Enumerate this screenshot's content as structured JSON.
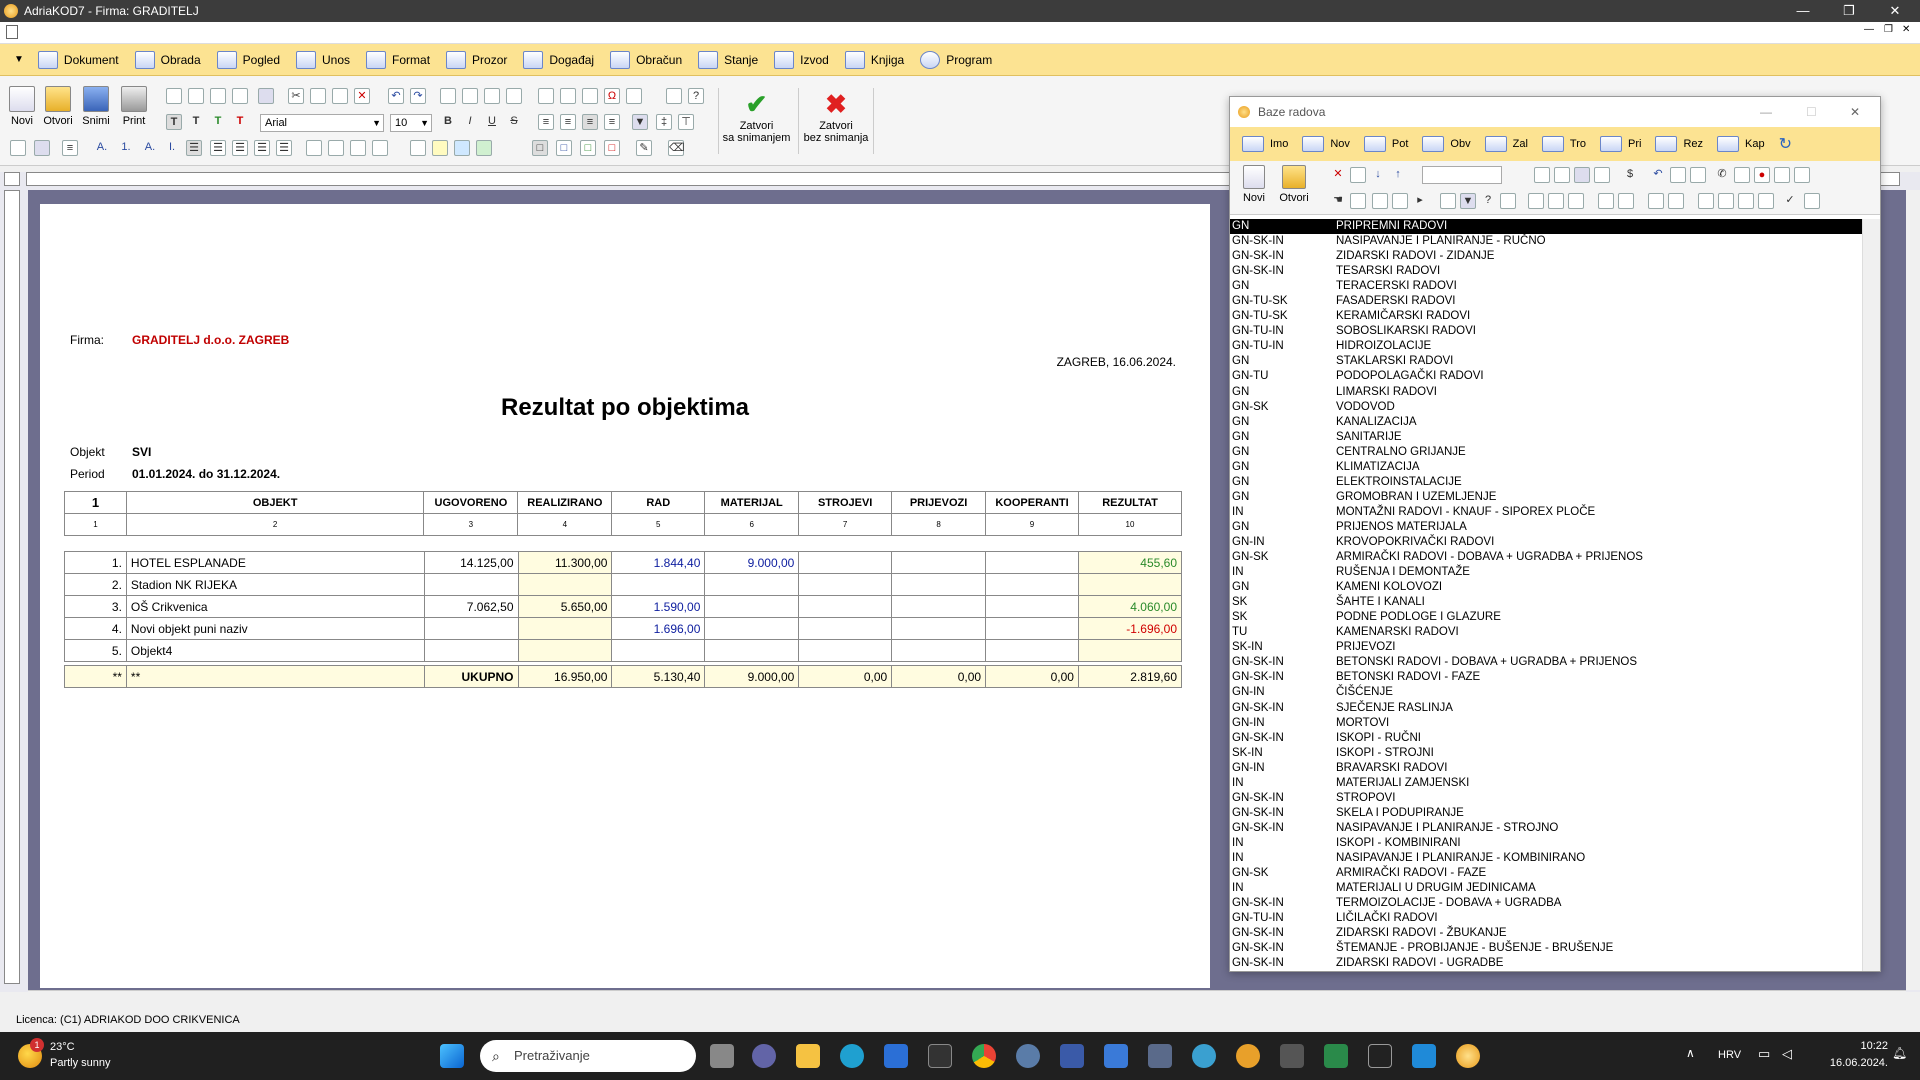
{
  "window": {
    "title": "AdriaKOD7 - Firma: GRADITELJ"
  },
  "menu": [
    {
      "label": "Dokument"
    },
    {
      "label": "Obrada"
    },
    {
      "label": "Pogled"
    },
    {
      "label": "Unos"
    },
    {
      "label": "Format"
    },
    {
      "label": "Prozor"
    },
    {
      "label": "Događaj"
    },
    {
      "label": "Obračun"
    },
    {
      "label": "Stanje"
    },
    {
      "label": "Izvod"
    },
    {
      "label": "Knjiga"
    },
    {
      "label": "Program"
    }
  ],
  "toolbar": {
    "new": "Novi",
    "open": "Otvori",
    "save": "Snimi",
    "print": "Print",
    "font": "Arial",
    "size": "10",
    "close_save_1": "Zatvori",
    "close_save_2": "sa snimanjem",
    "close_nosave_1": "Zatvori",
    "close_nosave_2": "bez snimanja"
  },
  "report": {
    "firma_label": "Firma:",
    "firma": "GRADITELJ d.o.o. ZAGREB",
    "place_date": "ZAGREB, 16.06.2024.",
    "title": "Rezultat po objektima",
    "objekt_label": "Objekt",
    "objekt": "SVI",
    "period_label": "Period",
    "period": "01.01.2024. do 31.12.2024.",
    "headers": [
      "1",
      "OBJEKT",
      "UGOVORENO",
      "REALIZIRANO",
      "RAD",
      "MATERIJAL",
      "STROJEVI",
      "PRIJEVOZI",
      "KOOPERANTI",
      "REZULTAT"
    ],
    "header_idx": [
      "1",
      "2",
      "3",
      "4",
      "5",
      "6",
      "7",
      "8",
      "9",
      "10"
    ],
    "rows": [
      {
        "n": "1.",
        "name": "HOTEL ESPLANADE",
        "ugov": "14.125,00",
        "real": "11.300,00",
        "rad": "1.844,40",
        "mat": "9.000,00",
        "str": "",
        "prij": "",
        "koop": "",
        "rez": "455,60",
        "neg": false
      },
      {
        "n": "2.",
        "name": "Stadion NK RIJEKA",
        "ugov": "",
        "real": "",
        "rad": "",
        "mat": "",
        "str": "",
        "prij": "",
        "koop": "",
        "rez": "",
        "neg": false
      },
      {
        "n": "3.",
        "name": "OŠ Crikvenica",
        "ugov": "7.062,50",
        "real": "5.650,00",
        "rad": "1.590,00",
        "mat": "",
        "str": "",
        "prij": "",
        "koop": "",
        "rez": "4.060,00",
        "neg": false
      },
      {
        "n": "4.",
        "name": "Novi objekt puni naziv",
        "ugov": "",
        "real": "",
        "rad": "1.696,00",
        "mat": "",
        "str": "",
        "prij": "",
        "koop": "",
        "rez": "-1.696,00",
        "neg": true
      },
      {
        "n": "5.",
        "name": "Objekt4",
        "ugov": "",
        "real": "",
        "rad": "",
        "mat": "",
        "str": "",
        "prij": "",
        "koop": "",
        "rez": "",
        "neg": false
      }
    ],
    "total": {
      "a": "**",
      "b": "**",
      "label": "UKUPNO",
      "real": "16.950,00",
      "rad": "5.130,40",
      "mat": "9.000,00",
      "str": "0,00",
      "prij": "0,00",
      "koop": "0,00",
      "rez": "2.819,60"
    }
  },
  "baze": {
    "title": "Baze radova",
    "tabs": [
      "Imo",
      "Nov",
      "Pot",
      "Obv",
      "Zal",
      "Tro",
      "Pri",
      "Rez",
      "Kap"
    ],
    "new": "Novi",
    "open": "Otvori",
    "items": [
      {
        "code": "GN",
        "name": "PRIPREMNI RADOVI"
      },
      {
        "code": "GN-SK-IN",
        "name": "NASIPAVANJE I PLANIRANJE - RUČNO"
      },
      {
        "code": "GN-SK-IN",
        "name": "ZIDARSKI RADOVI - ZIDANJE"
      },
      {
        "code": "GN-SK-IN",
        "name": "TESARSKI RADOVI"
      },
      {
        "code": "GN",
        "name": "TERACERSKI RADOVI"
      },
      {
        "code": "GN-TU-SK",
        "name": "FASADERSKI RADOVI"
      },
      {
        "code": "GN-TU-SK",
        "name": "KERAMIČARSKI RADOVI"
      },
      {
        "code": "GN-TU-IN",
        "name": "SOBOSLIKARSKI RADOVI"
      },
      {
        "code": "GN-TU-IN",
        "name": "HIDROIZOLACIJE"
      },
      {
        "code": "GN",
        "name": "STAKLARSKI RADOVI"
      },
      {
        "code": "GN-TU",
        "name": "PODOPOLAGAČKI RADOVI"
      },
      {
        "code": "GN",
        "name": "LIMARSKI RADOVI"
      },
      {
        "code": "GN-SK",
        "name": "VODOVOD"
      },
      {
        "code": "GN",
        "name": "KANALIZACIJA"
      },
      {
        "code": "GN",
        "name": "SANITARIJE"
      },
      {
        "code": "GN",
        "name": "CENTRALNO GRIJANJE"
      },
      {
        "code": "GN",
        "name": "KLIMATIZACIJA"
      },
      {
        "code": "GN",
        "name": "ELEKTROINSTALACIJE"
      },
      {
        "code": "GN",
        "name": "GROMOBRAN I UZEMLJENJE"
      },
      {
        "code": "IN",
        "name": "MONTAŽNI RADOVI - KNAUF - SIPOREX PLOČE"
      },
      {
        "code": "GN",
        "name": "PRIJENOS MATERIJALA"
      },
      {
        "code": "GN-IN",
        "name": "KROVOPOKRIVAČKI RADOVI"
      },
      {
        "code": "GN-SK",
        "name": "ARMIRAČKI RADOVI - DOBAVA + UGRADBA + PRIJENOS"
      },
      {
        "code": "IN",
        "name": "RUŠENJA I DEMONTAŽE"
      },
      {
        "code": "GN",
        "name": "KAMENI KOLOVOZI"
      },
      {
        "code": "SK",
        "name": "ŠAHTE I KANALI"
      },
      {
        "code": "SK",
        "name": "PODNE PODLOGE I GLAZURE"
      },
      {
        "code": "TU",
        "name": "KAMENARSKI RADOVI"
      },
      {
        "code": "SK-IN",
        "name": "PRIJEVOZI"
      },
      {
        "code": "GN-SK-IN",
        "name": "BETONSKI RADOVI - DOBAVA + UGRADBA + PRIJENOS"
      },
      {
        "code": "GN-SK-IN",
        "name": "BETONSKI RADOVI - FAZE"
      },
      {
        "code": "GN-IN",
        "name": "ČIŠĆENJE"
      },
      {
        "code": "GN-SK-IN",
        "name": "SJEČENJE RASLINJA"
      },
      {
        "code": "GN-IN",
        "name": "MORTOVI"
      },
      {
        "code": "GN-SK-IN",
        "name": "ISKOPI - RUČNI"
      },
      {
        "code": "SK-IN",
        "name": "ISKOPI - STROJNI"
      },
      {
        "code": "GN-IN",
        "name": "BRAVARSKI RADOVI"
      },
      {
        "code": "IN",
        "name": "MATERIJALI ZAMJENSKI"
      },
      {
        "code": "GN-SK-IN",
        "name": "STROPOVI"
      },
      {
        "code": "GN-SK-IN",
        "name": "SKELA I PODUPIRANJE"
      },
      {
        "code": "GN-SK-IN",
        "name": "NASIPAVANJE I PLANIRANJE - STROJNO"
      },
      {
        "code": "IN",
        "name": "ISKOPI - KOMBINIRANI"
      },
      {
        "code": "IN",
        "name": "NASIPAVANJE I PLANIRANJE - KOMBINIRANO"
      },
      {
        "code": "GN-SK",
        "name": "ARMIRAČKI RADOVI - FAZE"
      },
      {
        "code": "IN",
        "name": "MATERIJALI U DRUGIM JEDINICAMA"
      },
      {
        "code": "GN-SK-IN",
        "name": "TERMOIZOLACIJE - DOBAVA + UGRADBA"
      },
      {
        "code": "GN-TU-IN",
        "name": "LIČILAČKI RADOVI"
      },
      {
        "code": "GN-SK-IN",
        "name": "ZIDARSKI RADOVI - ŽBUKANJE"
      },
      {
        "code": "GN-SK-IN",
        "name": "ŠTEMANJE - PROBIJANJE - BUŠENJE - BRUŠENJE"
      },
      {
        "code": "GN-SK-IN",
        "name": "ZIDARSKI RADOVI - UGRADBE"
      }
    ]
  },
  "status": {
    "license": "Licenca:  (C1) ADRIAKOD DOO CRIKVENICA"
  },
  "taskbar": {
    "temp": "23°C",
    "weather": "Partly sunny",
    "badge": "1",
    "search": "Pretraživanje",
    "lang": "HRV",
    "time": "10:22",
    "date": "16.06.2024."
  },
  "colors": {
    "menubar": "#fce392",
    "firma": "#c00000",
    "negative": "#d00000",
    "positive": "#2a8a2a",
    "blue_value": "#1020a0"
  }
}
